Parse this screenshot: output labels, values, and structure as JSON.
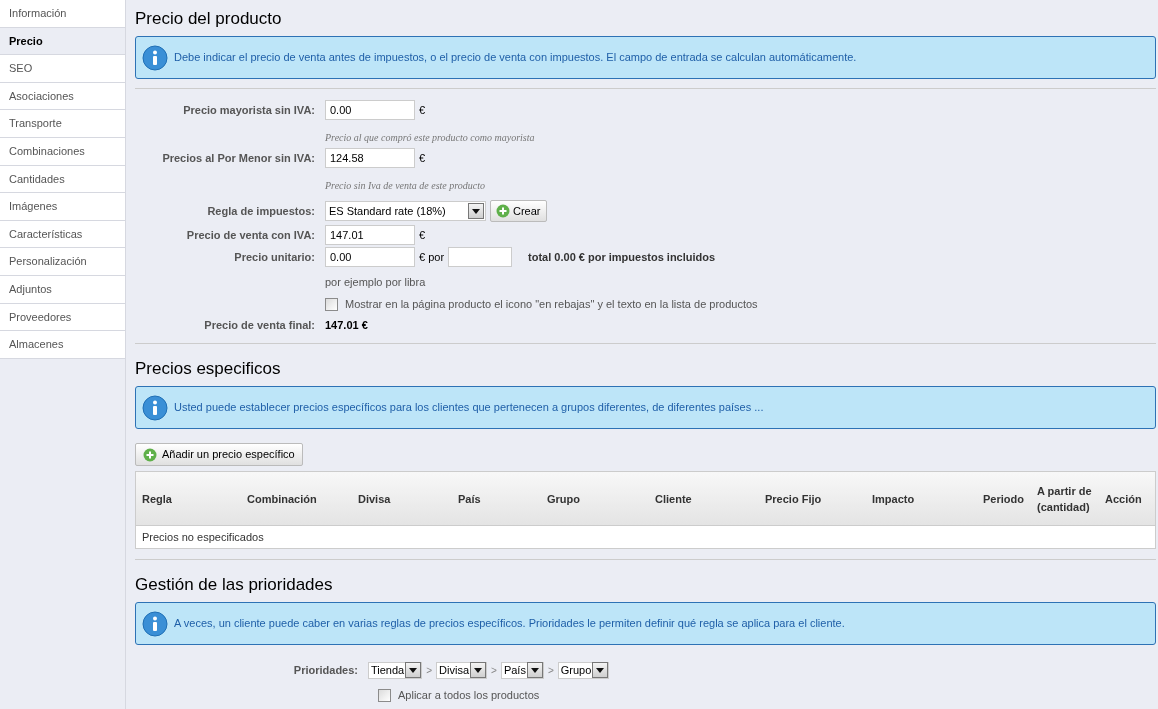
{
  "sidebar": {
    "items": [
      {
        "label": "Información",
        "selected": false
      },
      {
        "label": "Precio",
        "selected": true
      },
      {
        "label": "SEO",
        "selected": false
      },
      {
        "label": "Asociaciones",
        "selected": false
      },
      {
        "label": "Transporte",
        "selected": false
      },
      {
        "label": "Combinaciones",
        "selected": false
      },
      {
        "label": "Cantidades",
        "selected": false
      },
      {
        "label": "Imágenes",
        "selected": false
      },
      {
        "label": "Características",
        "selected": false
      },
      {
        "label": "Personalización",
        "selected": false
      },
      {
        "label": "Adjuntos",
        "selected": false
      },
      {
        "label": "Proveedores",
        "selected": false
      },
      {
        "label": "Almacenes",
        "selected": false
      }
    ]
  },
  "price_section": {
    "title": "Precio del producto",
    "info": "Debe indicar el precio de venta antes de impuestos, o el precio de venta con impuestos. El campo de entrada se calculan automáticamente.",
    "wholesale": {
      "label": "Precio mayorista sin IVA:",
      "value": "0.00",
      "unit": "€",
      "hint": "Precio al que compró este producto como mayorista"
    },
    "retail": {
      "label": "Precios al Por Menor sin IVA:",
      "value": "124.58",
      "unit": "€",
      "hint": "Precio sin Iva de venta de este producto"
    },
    "tax_rule": {
      "label": "Regla de impuestos:",
      "value": "ES Standard rate (18%)",
      "button": "Crear"
    },
    "with_tax": {
      "label": "Precio de venta con IVA:",
      "value": "147.01",
      "unit": "€"
    },
    "unit_price": {
      "label": "Precio unitario:",
      "value": "0.00",
      "unit": "€ por",
      "total": "total 0.00 € por impuestos incluidos",
      "hint": "por ejemplo por libra"
    },
    "on_sale": {
      "label": "Mostrar en la página producto el icono \"en rebajas\" y el texto en la lista de productos",
      "checked": false
    },
    "final": {
      "label": "Precio de venta final:",
      "value": "147.01 €"
    }
  },
  "specific_section": {
    "title": "Precios especificos",
    "info": "Usted puede establecer precios específicos para los clientes que pertenecen a grupos diferentes, de diferentes países ...",
    "add_button": "Añadir un precio específico",
    "table": {
      "columns": [
        "Regla",
        "Combinación",
        "Divisa",
        "País",
        "Grupo",
        "Cliente",
        "Precio Fijo",
        "Impacto",
        "Periodo",
        "A partir de (cantidad)",
        "Acción"
      ],
      "empty": "Precios no especificados"
    }
  },
  "priority_section": {
    "title": "Gestión de las prioridades",
    "info": "A veces, un cliente puede caber en varias reglas de precios específicos. Prioridades le permiten definir qué regla se aplica para el cliente.",
    "label": "Prioridades:",
    "selects": [
      "Tienda",
      "Divisa",
      "País",
      "Grupo"
    ],
    "separator": ">",
    "apply_all": {
      "label": "Aplicar a todos los productos",
      "checked": false
    }
  }
}
